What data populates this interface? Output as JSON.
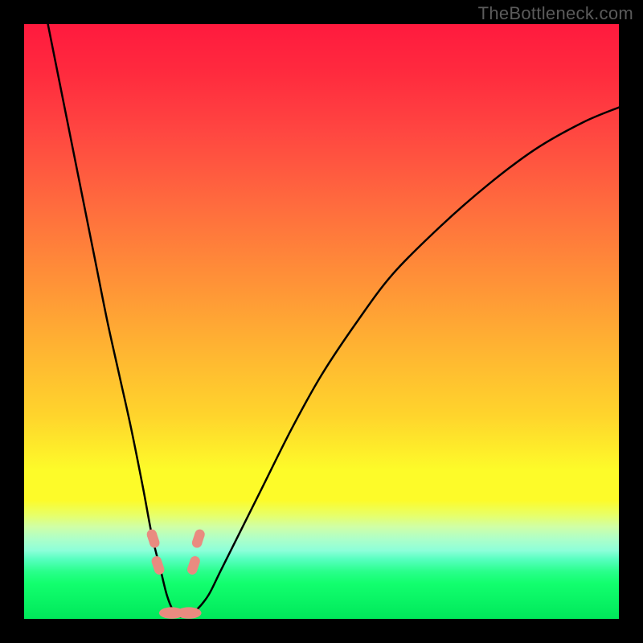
{
  "watermark": "TheBottleneck.com",
  "chart_data": {
    "type": "line",
    "title": "",
    "xlabel": "",
    "ylabel": "",
    "xlim": [
      0,
      100
    ],
    "ylim": [
      0,
      100
    ],
    "axes_visible": false,
    "grid": false,
    "background_gradient": {
      "direction": "vertical",
      "stops": [
        {
          "pos": 0.0,
          "color": "#ff1a3e"
        },
        {
          "pos": 0.6,
          "color": "#ffd52c"
        },
        {
          "pos": 0.8,
          "color": "#fdfb29"
        },
        {
          "pos": 0.92,
          "color": "#2aff8c"
        },
        {
          "pos": 1.0,
          "color": "#00e85a"
        }
      ]
    },
    "series": [
      {
        "name": "bottleneck-curve",
        "stroke": "#000000",
        "stroke_width": 2.5,
        "x": [
          4,
          6,
          8,
          10,
          12,
          14,
          16,
          18,
          20,
          21.5,
          23,
          24,
          25,
          26,
          27.5,
          29,
          31,
          33,
          36,
          40,
          45,
          50,
          56,
          62,
          70,
          78,
          86,
          94,
          100
        ],
        "y": [
          100,
          90,
          80,
          70,
          60,
          50,
          41,
          32,
          22,
          14,
          8,
          4,
          1.5,
          0.5,
          0.5,
          1.5,
          4,
          8,
          14,
          22,
          32,
          41,
          50,
          58,
          66,
          73,
          79,
          83.5,
          86
        ]
      }
    ],
    "markers": [
      {
        "name": "left-upper",
        "x": 21.7,
        "y": 13.5,
        "color": "#e98b80",
        "shape": "blob",
        "size": 10
      },
      {
        "name": "left-lower",
        "x": 22.5,
        "y": 9.0,
        "color": "#e98b80",
        "shape": "blob",
        "size": 10
      },
      {
        "name": "right-upper",
        "x": 29.3,
        "y": 13.5,
        "color": "#e98b80",
        "shape": "blob",
        "size": 10
      },
      {
        "name": "right-lower",
        "x": 28.5,
        "y": 9.0,
        "color": "#e98b80",
        "shape": "blob",
        "size": 10
      },
      {
        "name": "bottom-left",
        "x": 24.8,
        "y": 1.0,
        "color": "#e98b80",
        "shape": "blob-wide",
        "size": 12
      },
      {
        "name": "bottom-right",
        "x": 27.7,
        "y": 1.0,
        "color": "#e98b80",
        "shape": "blob-wide",
        "size": 12
      }
    ]
  }
}
